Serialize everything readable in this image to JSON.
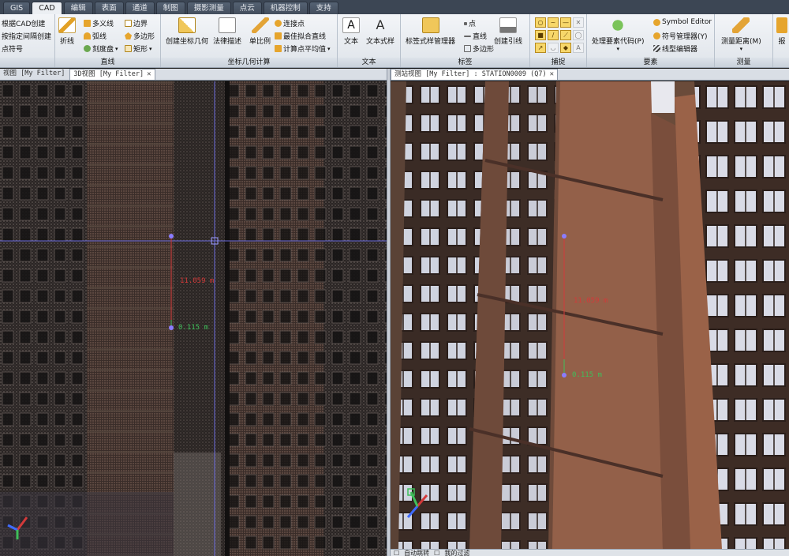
{
  "menu_tabs": [
    {
      "label": "GIS",
      "active": false
    },
    {
      "label": "CAD",
      "active": true
    },
    {
      "label": "编辑",
      "active": false
    },
    {
      "label": "表面",
      "active": false
    },
    {
      "label": "通道",
      "active": false
    },
    {
      "label": "制图",
      "active": false
    },
    {
      "label": "摄影测量",
      "active": false
    },
    {
      "label": "点云",
      "active": false
    },
    {
      "label": "机器控制",
      "active": false
    },
    {
      "label": "支持",
      "active": false
    }
  ],
  "ribbon": {
    "grp_first": {
      "label": "",
      "items": [
        "根据CAD创建",
        "按指定间隔创建",
        "点符号"
      ]
    },
    "grp_line": {
      "label": "直线",
      "polyline": "折线",
      "items": [
        "多义线",
        "弧线",
        "刻度盘",
        "边界",
        "多边形",
        "矩形"
      ]
    },
    "grp_coord": {
      "label": "坐标几何计算",
      "create_geometry": "创建坐标几何",
      "legal_desc": "法律描述",
      "scale": "单比例",
      "items": [
        "连接点",
        "最佳拟合直线",
        "计算点平均值"
      ]
    },
    "grp_text": {
      "label": "文本",
      "text": "文本",
      "text_style": "文本式样"
    },
    "grp_label": {
      "label": "标签",
      "style_manager": "标签式样管理器",
      "items": [
        "点",
        "直线",
        "多边形"
      ],
      "create_leader": "创建引线"
    },
    "grp_snap": {
      "label": "捕捉",
      "mode_count": 12
    },
    "grp_feature": {
      "label": "要素",
      "process_codes": "处理要素代码(P)",
      "items": [
        "Symbol Editor",
        "符号管理器(Y)",
        "线型编辑器"
      ]
    },
    "grp_measure": {
      "label": "测量",
      "measure_distance": "测量距离(M)"
    },
    "grp_report": {
      "label": "",
      "report": "报"
    }
  },
  "left_view": {
    "tabs": [
      {
        "label": "视图 [My Filter]",
        "active": false
      },
      {
        "label": "3D视图 [My Filter]",
        "active": true
      }
    ],
    "measure_distance": "11.059 m",
    "measure_small": "0.115 m"
  },
  "right_view": {
    "tab": "测站视图 [My Filter] : STATION0009 (Q7)",
    "measure_distance": "11.059 m",
    "measure_small": "0.115 m"
  },
  "statusbar": {
    "items": [
      "自动跳转",
      "我的过滤"
    ]
  },
  "colors": {
    "measure_red": "#d23a3a",
    "measure_green": "#3fbf5a",
    "crosshair": "#6a6adc",
    "snap_active": "#f7d76a"
  }
}
